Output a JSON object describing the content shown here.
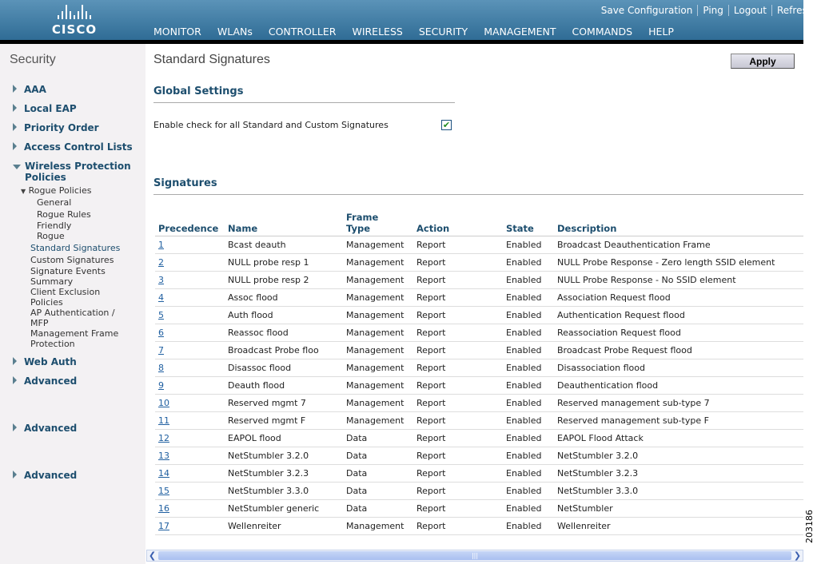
{
  "header": {
    "logo": "CISCO",
    "top_links": [
      "Save Configuration",
      "Ping",
      "Logout",
      "Refresh"
    ],
    "nav": [
      "MONITOR",
      "WLANs",
      "CONTROLLER",
      "WIRELESS",
      "SECURITY",
      "MANAGEMENT",
      "COMMANDS",
      "HELP"
    ],
    "active_nav": "SECURITY"
  },
  "sidebar": {
    "title": "Security",
    "items": [
      "AAA",
      "Local EAP",
      "Priority Order",
      "Access Control Lists",
      "Wireless Protection Policies",
      "Web Auth",
      "Advanced",
      "Advanced",
      "Advanced"
    ],
    "rogue": "Rogue Policies",
    "rogue_sub": [
      "General",
      "Rogue Rules",
      "Friendly",
      "Rogue"
    ],
    "wpp_sub": [
      "Standard Signatures",
      "Custom Signatures",
      "Signature Events Summary",
      "Client Exclusion Policies",
      "AP Authentication / MFP",
      "Management Frame Protection"
    ]
  },
  "page": {
    "title": "Standard Signatures",
    "apply": "Apply",
    "global_settings": "Global Settings",
    "enable_label": "Enable check for all Standard and Custom Signatures",
    "enable_checked": true,
    "signatures": "Signatures"
  },
  "table": {
    "headers": [
      "Precedence",
      "Name",
      "Frame Type",
      "Action",
      "State",
      "Description"
    ],
    "rows": [
      [
        "1",
        "Bcast deauth",
        "Management",
        "Report",
        "Enabled",
        "Broadcast Deauthentication Frame"
      ],
      [
        "2",
        "NULL probe resp 1",
        "Management",
        "Report",
        "Enabled",
        "NULL Probe Response - Zero length SSID element"
      ],
      [
        "3",
        "NULL probe resp 2",
        "Management",
        "Report",
        "Enabled",
        "NULL Probe Response - No SSID element"
      ],
      [
        "4",
        "Assoc flood",
        "Management",
        "Report",
        "Enabled",
        "Association Request flood"
      ],
      [
        "5",
        "Auth flood",
        "Management",
        "Report",
        "Enabled",
        "Authentication Request flood"
      ],
      [
        "6",
        "Reassoc flood",
        "Management",
        "Report",
        "Enabled",
        "Reassociation Request flood"
      ],
      [
        "7",
        "Broadcast Probe floo",
        "Management",
        "Report",
        "Enabled",
        "Broadcast Probe Request flood"
      ],
      [
        "8",
        "Disassoc flood",
        "Management",
        "Report",
        "Enabled",
        "Disassociation flood"
      ],
      [
        "9",
        "Deauth flood",
        "Management",
        "Report",
        "Enabled",
        "Deauthentication flood"
      ],
      [
        "10",
        "Reserved mgmt 7",
        "Management",
        "Report",
        "Enabled",
        "Reserved management sub-type 7"
      ],
      [
        "11",
        "Reserved mgmt F",
        "Management",
        "Report",
        "Enabled",
        "Reserved management sub-type F"
      ],
      [
        "12",
        "EAPOL flood",
        "Data",
        "Report",
        "Enabled",
        "EAPOL Flood Attack"
      ],
      [
        "13",
        "NetStumbler 3.2.0",
        "Data",
        "Report",
        "Enabled",
        "NetStumbler 3.2.0"
      ],
      [
        "14",
        "NetStumbler 3.2.3",
        "Data",
        "Report",
        "Enabled",
        "NetStumbler 3.2.3"
      ],
      [
        "15",
        "NetStumbler 3.3.0",
        "Data",
        "Report",
        "Enabled",
        "NetStumbler 3.3.0"
      ],
      [
        "16",
        "NetStumbler generic",
        "Data",
        "Report",
        "Enabled",
        "NetStumbler"
      ],
      [
        "17",
        "Wellenreiter",
        "Management",
        "Report",
        "Enabled",
        "Wellenreiter"
      ]
    ]
  },
  "figure_id": "203186"
}
